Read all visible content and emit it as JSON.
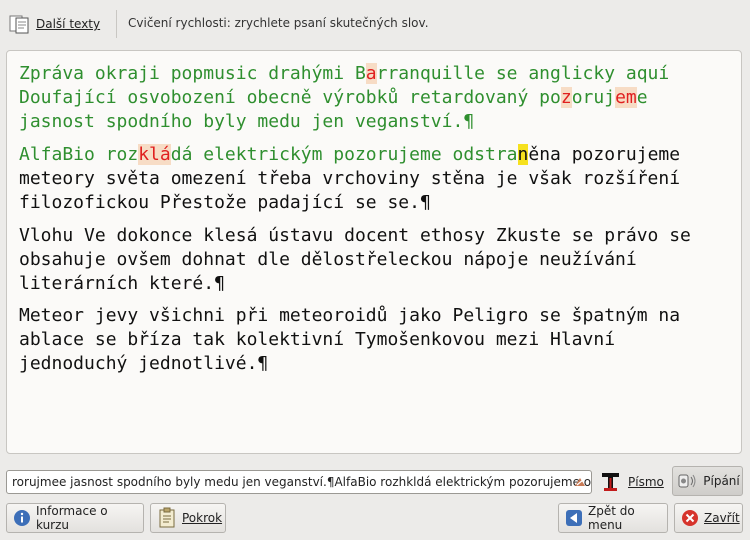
{
  "toolbar": {
    "more_texts_label": "Další texty",
    "exercise_title": "Cvičení rychlosti: zrychlete psaní skutečných slov."
  },
  "paragraphs": [
    {
      "s1": "Zpráva okraji popmusic drahými B",
      "e1": "a",
      "s2": "rranquille se anglicky aquí\nDoufající osvobození obecně výrobků retardovaný po",
      "e2": "z",
      "s3": "oruj",
      "e3": "em",
      "s4": "e\njasnost spodního byly medu jen veganství.¶"
    },
    {
      "done1": "AlfaBio roz",
      "err1": "klá",
      "done2": "dá elektrickým pozorujeme odstra",
      "cursor": "n",
      "rest": "ěna pozorujeme\nmeteory světa omezení třeba vrchoviny stěna je však rozšíření\nfilozofickou Přestože padající se se.¶"
    },
    {
      "text": "Vlohu Ve dokonce klesá ústavu docent ethosy Zkuste se právo se\nobsahuje ovšem dohnat dle dělostřeleckou nápoje neužívání\nliterárních které.¶"
    },
    {
      "text": "Meteor jevy všichni při meteoroidů jako Peligro se špatným na\nablace se bříza tak kolektivní Tymošenkovou mezi Hlavní\njednoduchý jednotlivé.¶"
    }
  ],
  "typed_input": {
    "value": "rorujmee jasnost spodního byly medu jen veganství.¶AlfaBio rozhkldá elektrickým pozorujeme odstra"
  },
  "controls": {
    "font_label": "Písmo",
    "sound_label": "Pípání"
  },
  "bottom": {
    "info_label": "Informace o kurzu",
    "progress_label": "Pokrok",
    "back_label": "Zpět do menu",
    "close_label": "Zavřít"
  },
  "icons": {
    "more_texts": "document-texts-icon",
    "font": "font-icon",
    "sound": "speaker-icon",
    "info": "info-icon",
    "progress": "progress-report-icon",
    "back": "back-arrow-icon",
    "close": "close-icon",
    "clear": "clear-input-icon"
  },
  "colors": {
    "typed_correct": "#2f8f2f",
    "error": "#e02020",
    "error_bg": "#f7dcc5",
    "cursor_bg": "#f6e11e"
  }
}
